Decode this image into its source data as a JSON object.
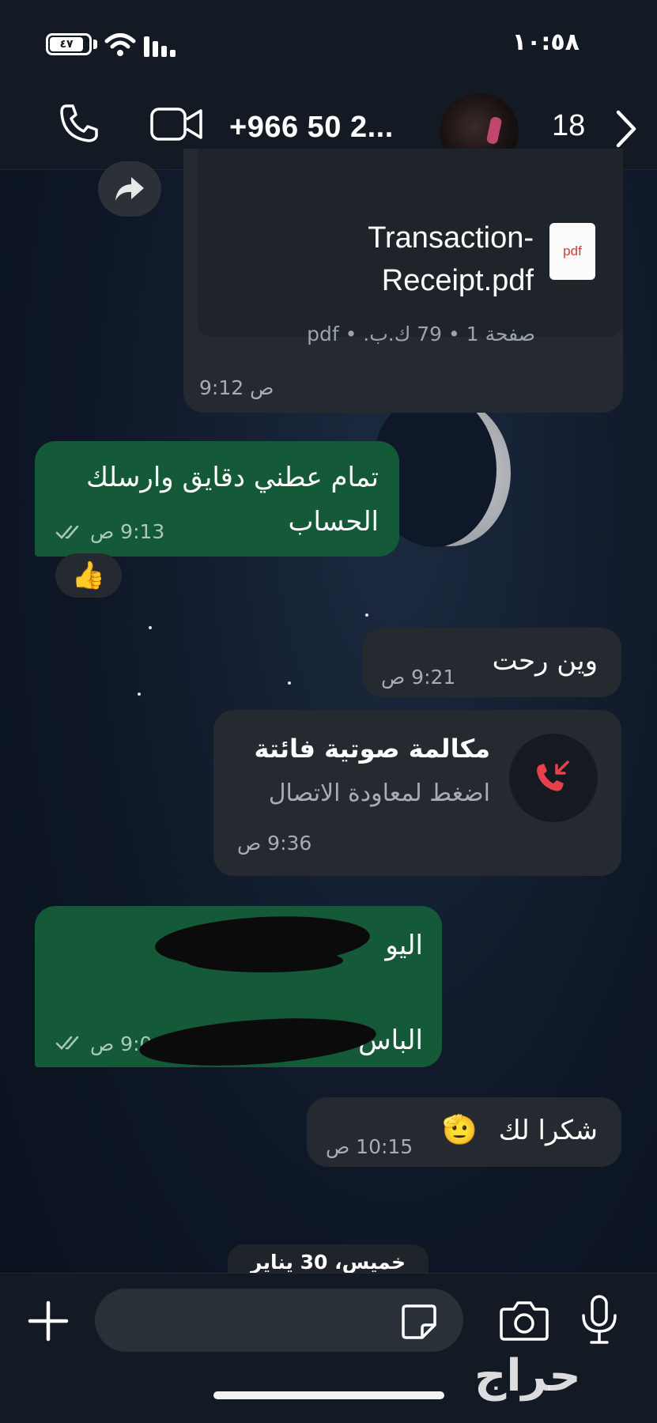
{
  "status_bar": {
    "time": "١٠:٥٨",
    "battery": "٤٧"
  },
  "header": {
    "contact_name": "+966 50 2...",
    "unread_count": "18"
  },
  "messages": [
    {
      "id": "pdf",
      "direction": "incoming",
      "file_type_label": "pdf",
      "file_name": "Transaction-Receipt.pdf",
      "file_info": "صفحة 1 • 79 ك.ب. • pdf",
      "time": "9:12 ص"
    },
    {
      "id": "913",
      "direction": "outgoing",
      "text": "تمام عطني دقايق وارسلك الحساب",
      "time": "9:13 ص",
      "reaction": "👍"
    },
    {
      "id": "921",
      "direction": "incoming",
      "text": "وين رحت",
      "time": "9:21 ص"
    },
    {
      "id": "936",
      "direction": "incoming",
      "type": "missed-call",
      "title": "مكالمة صوتية فائتة",
      "subtitle": "اضغط لمعاودة الاتصال",
      "time": "9:36 ص"
    },
    {
      "id": "redacted",
      "direction": "outgoing",
      "line1": "اليو",
      "line2": "الباس",
      "time": "9:0 ص"
    },
    {
      "id": "1015",
      "direction": "incoming",
      "text": "شكرا لك",
      "emoji": "🫡",
      "time": "10:15 ص"
    }
  ],
  "date_separator": "خميس، 30 يناير",
  "composer": {
    "placeholder": ""
  },
  "watermark": "حراج",
  "colors": {
    "outgoing_bubble": "#145a38",
    "incoming_bubble": "#252a31",
    "missed_call": "#e8404a",
    "read_ticks": "#a9c8b8"
  },
  "icons": [
    "phone-icon",
    "video-call-icon",
    "chevron-right-icon",
    "forward-icon",
    "pdf-icon",
    "missed-call-icon",
    "plus-icon",
    "sticker-icon",
    "camera-icon",
    "microphone-icon",
    "double-check-icon",
    "wifi-icon",
    "signal-icon",
    "battery-icon"
  ]
}
